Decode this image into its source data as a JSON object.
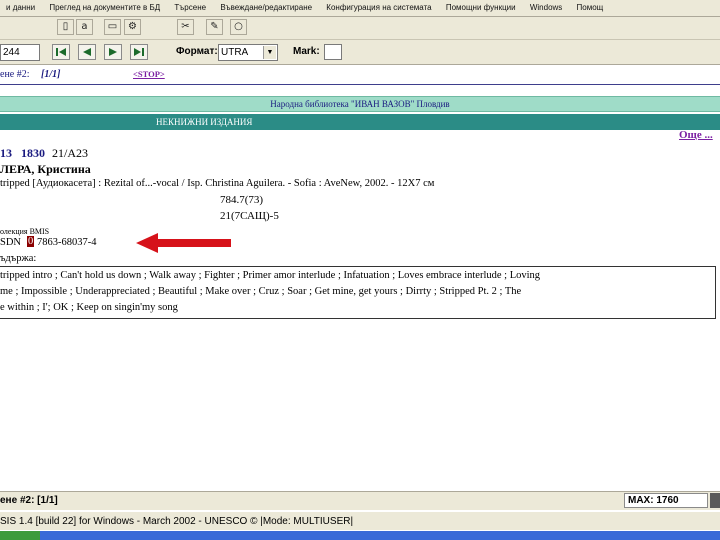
{
  "menu": [
    "и данни",
    "Преглед на документите в БД",
    "Търсене",
    "Въвеждане/редактиране",
    "Конфигурация на системата",
    "Помощни функции",
    "Windows",
    "Помощ"
  ],
  "toolbar1": {
    "icons": [
      "book-icon",
      "alphabet-icon",
      "document-icon",
      "gear-icon",
      "cut-icon",
      "pencil-icon",
      "bulb-icon"
    ]
  },
  "toolbar2": {
    "record_no": "244",
    "format_label": "Формат:",
    "format_value": "UTRA",
    "mark_label": "Mark:"
  },
  "record_header": {
    "prefix": "ене #2: ",
    "position": "[1/1]",
    "stop_link": "<STOP>"
  },
  "library": {
    "name": "Народна библиотека \"ИВАН ВАЗОВ\"  Пловдив",
    "collection": "НЕКНИЖНИ  ИЗДАНИЯ",
    "other_link": "Още ..."
  },
  "record": {
    "id_prefix": "13",
    "id_number": "1830",
    "call_number": "21/A23",
    "author": "ЛЕРА, Кристина",
    "title_line": "tripped [Аудиокасета] : Rezital of...-vocal / Isp. Christina Aguilera. - Sofia : AveNew, 2002. - 12X7 см",
    "class1": "784.7(73)",
    "class2": "21(7САЩ)-5",
    "collection_note": "олекция BMIS",
    "isbn_label": "SDN",
    "isbn_highlight": "0",
    "isbn_rest": "7863-68037-4",
    "contents_label": "ъдържа:",
    "contents_line1": "tripped intro ; Can't hold us down ; Walk away ; Fighter ; Primer amor interlude ; Infatuation ; Loves embrace interlude ; Loving",
    "contents_line2": " me ; Impossible ; Underappreciated ; Beautiful ; Make over ; Cruz ; Soar ; Get mine, get yours ; Dirrty ; Stripped Pt. 2 ; The",
    "contents_line3": "e within ; I'; OK ; Keep on singin'my song"
  },
  "status": {
    "record_info": "ене #2: [1/1]",
    "max_label": "MAX: 1760",
    "app_info": "SIS 1.4 [build 22] for Windows - March 2002 - UNESCO ©  |Mode: MULTIUSER|"
  },
  "colors": {
    "band_light": "#9fdcc8",
    "band_dark": "#2b8c86",
    "link": "#7b1fa2",
    "arrow": "#d6121a",
    "isbn_highlight_bg": "#8b0000"
  }
}
